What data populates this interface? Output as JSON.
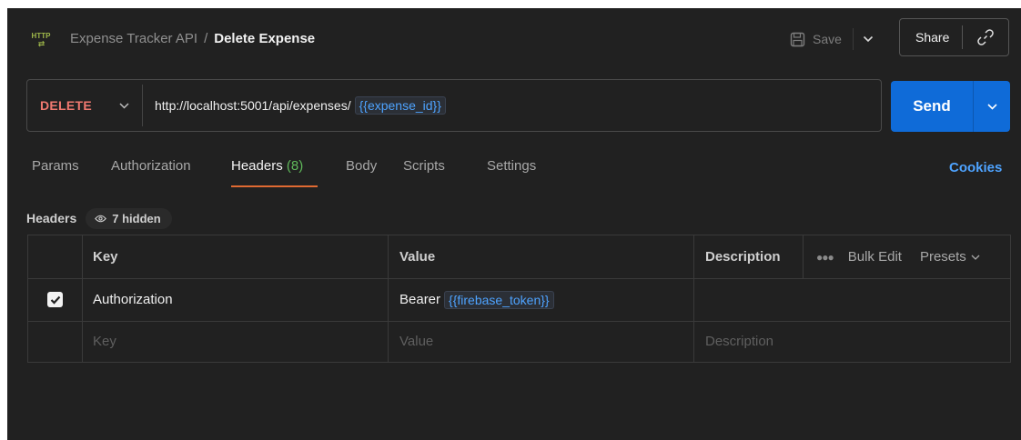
{
  "header": {
    "icon": "http-request-icon",
    "icon_text": "HTTP",
    "breadcrumb_parent": "Expense Tracker API",
    "breadcrumb_separator": "/",
    "breadcrumb_current": "Delete Expense",
    "save_label": "Save",
    "share_label": "Share"
  },
  "request": {
    "method": "DELETE",
    "url_base": "http://localhost:5001/api/expenses/",
    "url_variable": "{{expense_id}}",
    "send_label": "Send"
  },
  "tabs": [
    {
      "label": "Params"
    },
    {
      "label": "Authorization"
    },
    {
      "label": "Headers",
      "count": "(8)",
      "active": true
    },
    {
      "label": "Body"
    },
    {
      "label": "Scripts"
    },
    {
      "label": "Settings"
    }
  ],
  "cookies_label": "Cookies",
  "headers_section": {
    "label": "Headers",
    "hidden_label": "7 hidden"
  },
  "table": {
    "columns": {
      "key": "Key",
      "value": "Value",
      "description": "Description"
    },
    "bulk_edit_label": "Bulk Edit",
    "presets_label": "Presets",
    "rows": [
      {
        "checked": true,
        "key": "Authorization",
        "value_prefix": "Bearer",
        "value_variable": "{{firebase_token}}"
      }
    ],
    "placeholders": {
      "key": "Key",
      "value": "Value",
      "description": "Description"
    }
  },
  "colors": {
    "background": "#212121",
    "method_delete": "#f07970",
    "send_button": "#0f6bd8",
    "variable": "#4ea3ff",
    "active_tab_underline": "#e06a32",
    "header_count": "#5fb85a"
  }
}
